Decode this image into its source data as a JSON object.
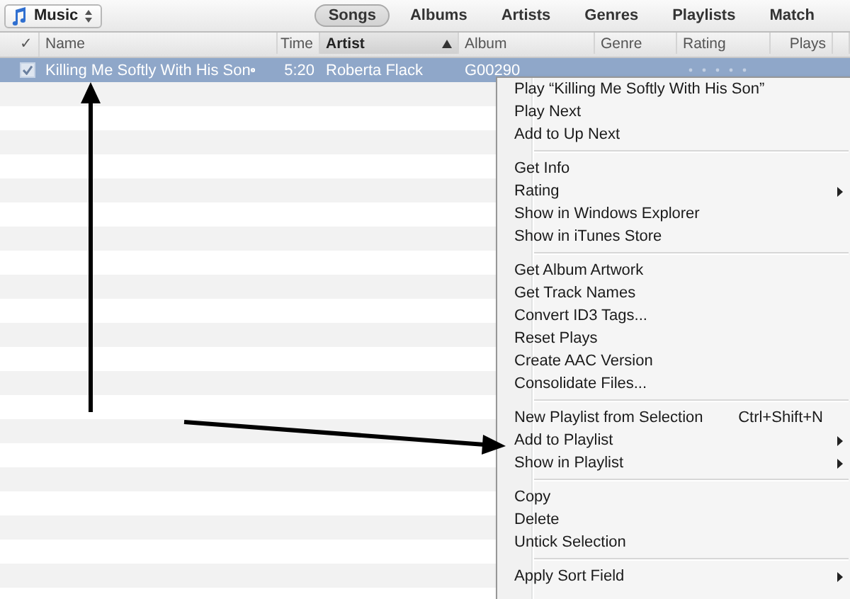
{
  "library_selector": {
    "label": "Music"
  },
  "tabs": [
    {
      "label": "Songs",
      "selected": true
    },
    {
      "label": "Albums",
      "selected": false
    },
    {
      "label": "Artists",
      "selected": false
    },
    {
      "label": "Genres",
      "selected": false
    },
    {
      "label": "Playlists",
      "selected": false
    },
    {
      "label": "Match",
      "selected": false
    }
  ],
  "table": {
    "check_column": "✓",
    "columns": [
      {
        "label": "Name",
        "sorted": false
      },
      {
        "label": "Time",
        "sorted": false
      },
      {
        "label": "Artist",
        "sorted": true
      },
      {
        "label": "Album",
        "sorted": false
      },
      {
        "label": "Genre",
        "sorted": false
      },
      {
        "label": "Rating",
        "sorted": false
      },
      {
        "label": "Plays",
        "sorted": false
      }
    ],
    "rows": [
      {
        "checked": true,
        "selected": true,
        "name": "Killing Me Softly With His Son",
        "time": "5:20",
        "artist": "Roberta Flack",
        "album": "G00290"
      }
    ]
  },
  "context_menu": {
    "groups": [
      [
        {
          "label": "Play “Killing Me Softly With His Son”",
          "submenu": false
        },
        {
          "label": "Play Next",
          "submenu": false
        },
        {
          "label": "Add to Up Next",
          "submenu": false
        }
      ],
      [
        {
          "label": "Get Info",
          "submenu": false
        },
        {
          "label": "Rating",
          "submenu": true
        },
        {
          "label": "Show in Windows Explorer",
          "submenu": false
        },
        {
          "label": "Show in iTunes Store",
          "submenu": false
        }
      ],
      [
        {
          "label": "Get Album Artwork",
          "submenu": false
        },
        {
          "label": "Get Track Names",
          "submenu": false
        },
        {
          "label": "Convert ID3 Tags...",
          "submenu": false
        },
        {
          "label": "Reset Plays",
          "submenu": false
        },
        {
          "label": "Create AAC Version",
          "submenu": false
        },
        {
          "label": "Consolidate Files...",
          "submenu": false
        }
      ],
      [
        {
          "label": "New Playlist from Selection",
          "shortcut": "Ctrl+Shift+N",
          "submenu": false
        },
        {
          "label": "Add to Playlist",
          "submenu": true
        },
        {
          "label": "Show in Playlist",
          "submenu": true
        }
      ],
      [
        {
          "label": "Copy",
          "submenu": false
        },
        {
          "label": "Delete",
          "submenu": false
        },
        {
          "label": "Untick Selection",
          "submenu": false
        }
      ],
      [
        {
          "label": "Apply Sort Field",
          "submenu": true
        }
      ]
    ]
  }
}
